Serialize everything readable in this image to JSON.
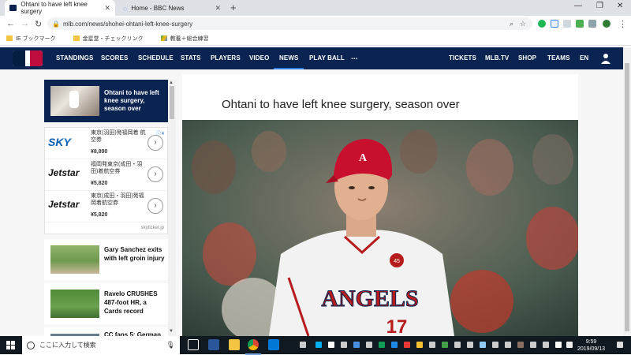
{
  "browser": {
    "tabs": [
      {
        "title": "Ohtani to have left knee surgery",
        "active": true
      },
      {
        "title": "Home - BBC News",
        "active": false
      }
    ],
    "url": "mlb.com/news/shohei-ohtani-left-knee-surgery",
    "bookmarks": [
      "IE ブックマーク",
      "金星堂・チェックリンク",
      "教養＋総合練習"
    ]
  },
  "mlb_nav": {
    "items": [
      "STANDINGS",
      "SCORES",
      "SCHEDULE",
      "STATS",
      "PLAYERS",
      "VIDEO",
      "NEWS",
      "PLAY BALL",
      "..."
    ],
    "right_items": [
      "TICKETS",
      "MLB.TV",
      "SHOP",
      "TEAMS",
      "EN"
    ],
    "active": "NEWS"
  },
  "sidebar": {
    "top_card": "Ohtani to have left knee surgery, season over",
    "ad": {
      "rows": [
        {
          "brand": "SKY",
          "route": "東京(羽田)発福岡着 航空券",
          "price": "¥8,890"
        },
        {
          "brand": "Jetstar",
          "route": "福岡発東京(成田・羽田)着航空券",
          "price": "¥5,820"
        },
        {
          "brand": "Jetstar",
          "route": "東京(成田・羽田)発福岡着航空券",
          "price": "¥5,820"
        }
      ],
      "source": "skyticket.jp"
    },
    "news": [
      "Gary Sanchez exits with left groin injury",
      "Ravelo CRUSHES 487-foot HR, a Cards record",
      "CC fans 5; German"
    ]
  },
  "article": {
    "headline": "Ohtani to have left knee surgery, season over",
    "jersey_text": "ANGELS",
    "jersey_number": "17",
    "helmet_logo": "A"
  },
  "taskbar": {
    "search_placeholder": "ここに入力して検索",
    "time": "9:59",
    "date": "2019/09/13"
  }
}
